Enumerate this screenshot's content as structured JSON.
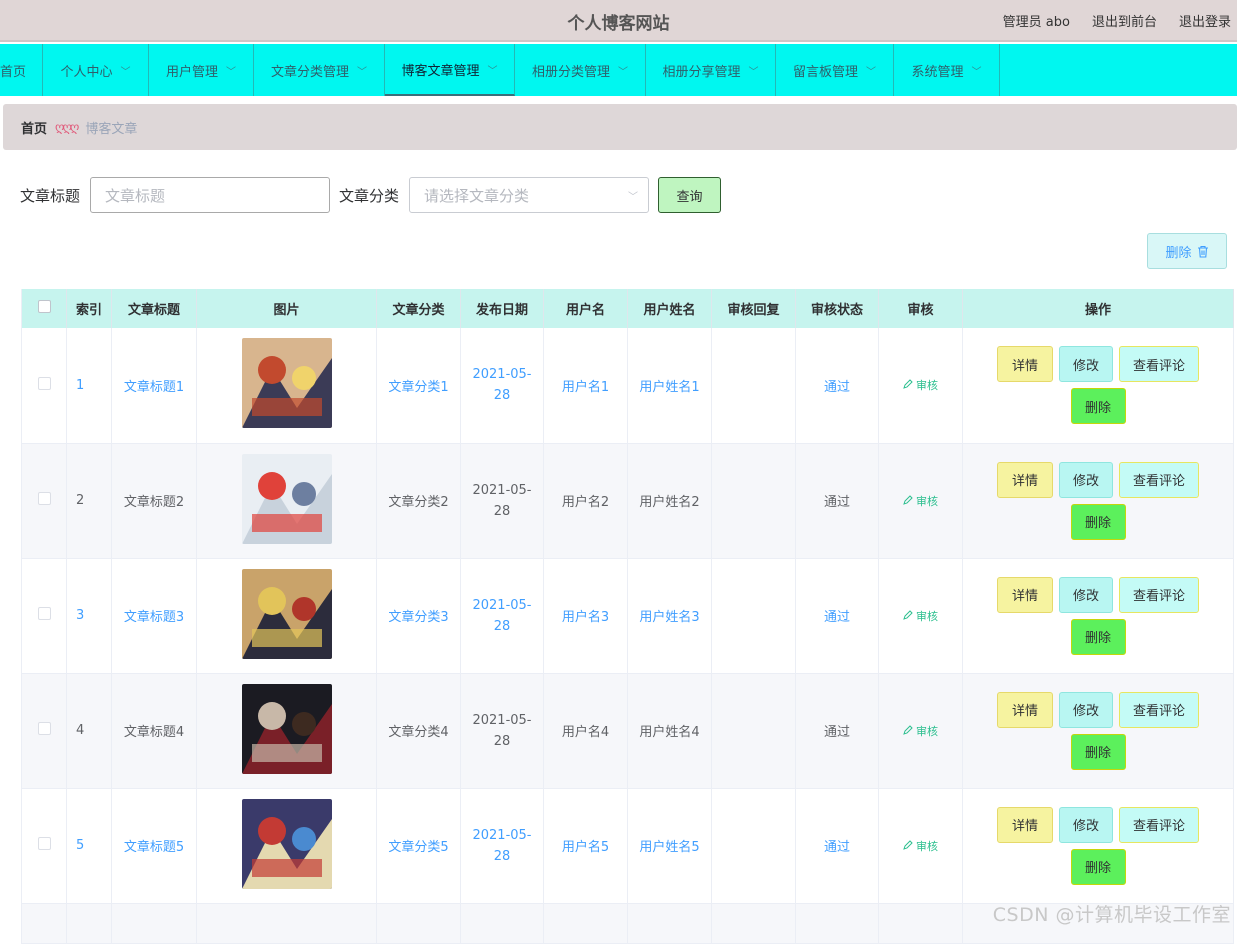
{
  "header": {
    "title": "个人博客网站",
    "admin": "管理员 abo",
    "to_front": "退出到前台",
    "logout": "退出登录"
  },
  "nav": {
    "items": [
      {
        "label": "首页",
        "dropdown": false
      },
      {
        "label": "个人中心",
        "dropdown": true
      },
      {
        "label": "用户管理",
        "dropdown": true
      },
      {
        "label": "文章分类管理",
        "dropdown": true
      },
      {
        "label": "博客文章管理",
        "dropdown": true,
        "active": true
      },
      {
        "label": "相册分类管理",
        "dropdown": true
      },
      {
        "label": "相册分享管理",
        "dropdown": true
      },
      {
        "label": "留言板管理",
        "dropdown": true
      },
      {
        "label": "系统管理",
        "dropdown": true
      }
    ]
  },
  "breadcrumb": {
    "home": "首页",
    "separator": "ღღღ",
    "current": "博客文章"
  },
  "search": {
    "title_label": "文章标题",
    "title_placeholder": "文章标题",
    "category_label": "文章分类",
    "category_placeholder": "请选择文章分类",
    "query_button": "查询"
  },
  "batch_delete": "删除",
  "table": {
    "headers": [
      "索引",
      "文章标题",
      "图片",
      "文章分类",
      "发布日期",
      "用户名",
      "用户姓名",
      "审核回复",
      "审核状态",
      "审核",
      "操作"
    ],
    "rows": [
      {
        "index": "1",
        "title": "文章标题1",
        "category": "文章分类1",
        "date": "2021-05-28",
        "username": "用户名1",
        "name": "用户姓名1",
        "reply": "",
        "status": "通过",
        "review": "审核"
      },
      {
        "index": "2",
        "title": "文章标题2",
        "category": "文章分类2",
        "date": "2021-05-28",
        "username": "用户名2",
        "name": "用户姓名2",
        "reply": "",
        "status": "通过",
        "review": "审核"
      },
      {
        "index": "3",
        "title": "文章标题3",
        "category": "文章分类3",
        "date": "2021-05-28",
        "username": "用户名3",
        "name": "用户姓名3",
        "reply": "",
        "status": "通过",
        "review": "审核"
      },
      {
        "index": "4",
        "title": "文章标题4",
        "category": "文章分类4",
        "date": "2021-05-28",
        "username": "用户名4",
        "name": "用户姓名4",
        "reply": "",
        "status": "通过",
        "review": "审核"
      },
      {
        "index": "5",
        "title": "文章标题5",
        "category": "文章分类5",
        "date": "2021-05-28",
        "username": "用户名5",
        "name": "用户姓名5",
        "reply": "",
        "status": "通过",
        "review": "审核"
      }
    ],
    "actions": {
      "detail": "详情",
      "edit": "修改",
      "comments": "查看评论",
      "delete": "删除"
    }
  },
  "watermark": "CSDN @计算机毕设工作室",
  "colors": {
    "nav_bg": "#00f7f0",
    "header_bg": "#e0d6d6",
    "table_header_bg": "#c6f4ee",
    "link_blue": "#409eff"
  }
}
